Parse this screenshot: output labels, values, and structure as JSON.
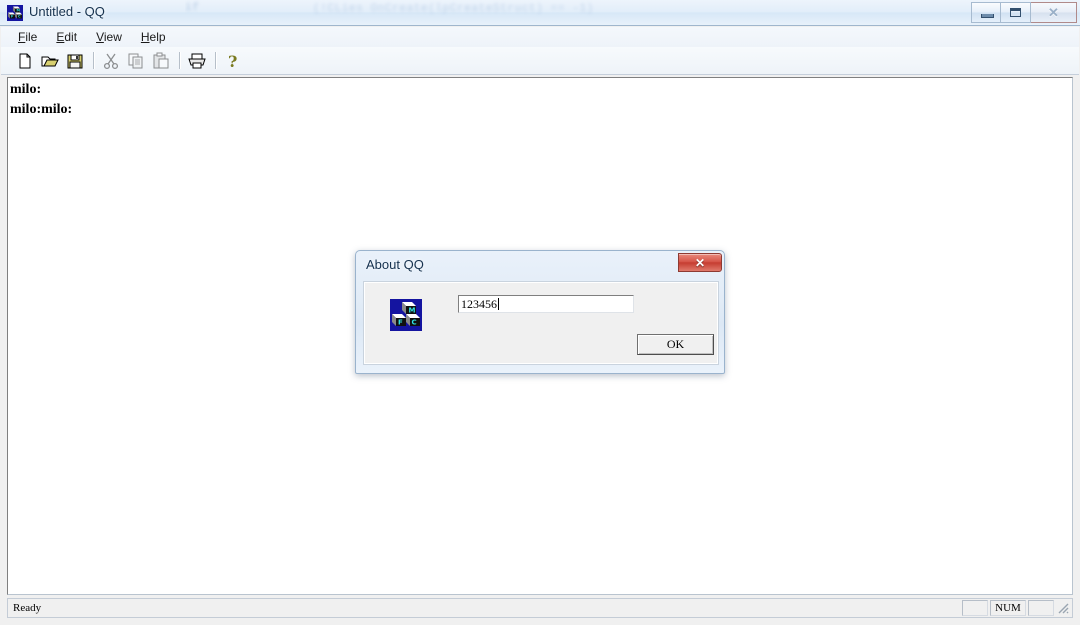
{
  "window": {
    "title": "Untitled - QQ",
    "icon": "mfc-cube-icon",
    "ghost_text_1": "if",
    "ghost_text_2": "(!CLies  OnCreate(lpCreateStruct) == -1)",
    "controls": {
      "minimize_label": "–",
      "maximize_label": "□",
      "close_label": "✕"
    }
  },
  "menubar": {
    "items": [
      {
        "label": "File",
        "accel": "F",
        "rest": "ile"
      },
      {
        "label": "Edit",
        "accel": "E",
        "rest": "dit"
      },
      {
        "label": "View",
        "accel": "V",
        "rest": "iew"
      },
      {
        "label": "Help",
        "accel": "H",
        "rest": "elp"
      }
    ]
  },
  "toolbar": {
    "buttons": [
      {
        "name": "new-file-icon",
        "label": "New",
        "enabled": true
      },
      {
        "name": "open-file-icon",
        "label": "Open",
        "enabled": true
      },
      {
        "name": "save-file-icon",
        "label": "Save",
        "enabled": true
      },
      {
        "name": "cut-icon",
        "label": "Cut",
        "enabled": false
      },
      {
        "name": "copy-icon",
        "label": "Copy",
        "enabled": false
      },
      {
        "name": "paste-icon",
        "label": "Paste",
        "enabled": false
      },
      {
        "name": "print-icon",
        "label": "Print",
        "enabled": true
      },
      {
        "name": "help-icon",
        "label": "About",
        "enabled": true
      }
    ]
  },
  "document": {
    "lines": [
      "milo:",
      "milo:milo:"
    ],
    "text": "milo:\nmilo:milo:"
  },
  "statusbar": {
    "message": "Ready",
    "pane_blank_left": "",
    "pane_num": "NUM",
    "pane_blank_right": ""
  },
  "dialog": {
    "title": "About QQ",
    "close_label": "✕",
    "logo": "mfc-cube-icon",
    "input": {
      "value": "123456",
      "placeholder": ""
    },
    "ok_button": "OK"
  },
  "colors": {
    "aero_glass": "#e2ecf7",
    "title_text": "#16324f",
    "close_red": "#c63d31",
    "client_bg": "#ffffff",
    "chrome_bg": "#f0f0f0"
  }
}
